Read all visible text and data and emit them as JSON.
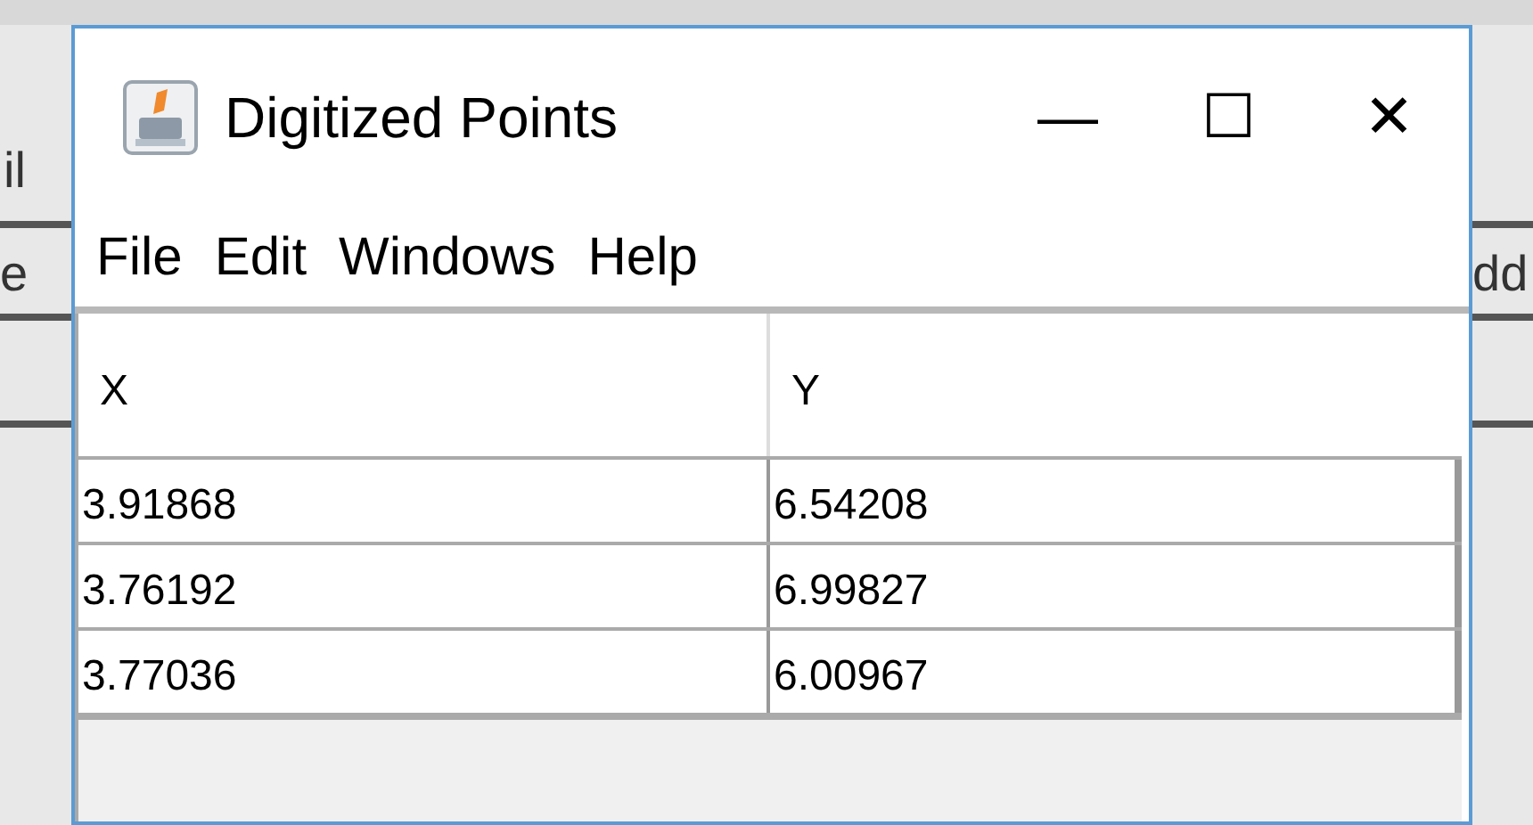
{
  "background_window": {
    "fragments": [
      "il",
      "e",
      "dd"
    ]
  },
  "window": {
    "title": "Digitized Points",
    "controls": [
      "—",
      "☐",
      "✕"
    ]
  },
  "menu": [
    "File",
    "Edit",
    "Windows",
    "Help"
  ],
  "table": {
    "columns": [
      "X",
      "Y"
    ],
    "rows": [
      [
        "3.91868",
        "6.54208"
      ],
      [
        "3.76192",
        "6.99827"
      ],
      [
        "3.77036",
        "6.00967"
      ]
    ]
  }
}
